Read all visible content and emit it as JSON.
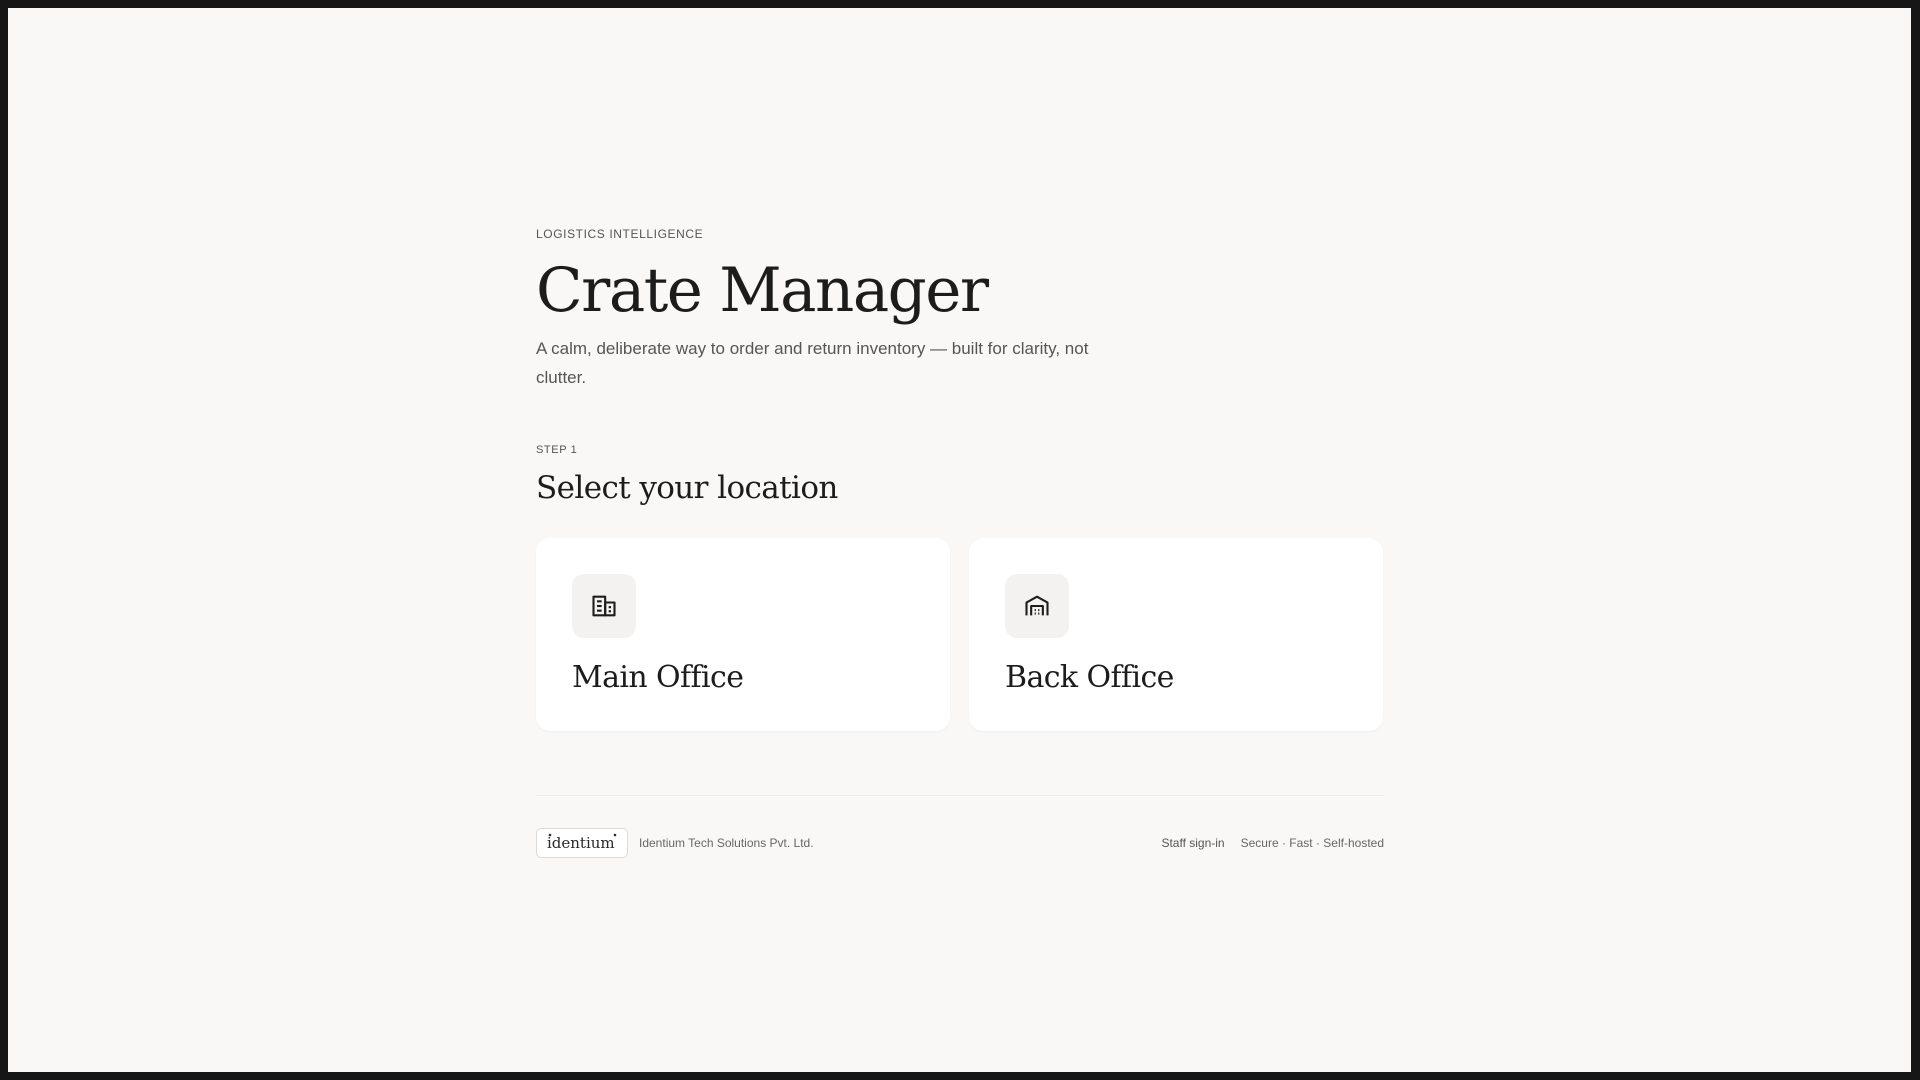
{
  "hero": {
    "eyebrow": "LOGISTICS INTELLIGENCE",
    "title": "Crate Manager",
    "subtitle": "A calm, deliberate way to order and return inventory — built for clarity, not clutter."
  },
  "step": {
    "label": "STEP 1",
    "title": "Select your location"
  },
  "locations": [
    {
      "label": "Main Office",
      "icon": "building-icon"
    },
    {
      "label": "Back Office",
      "icon": "warehouse-icon"
    }
  ],
  "footer": {
    "logo_text": "identium",
    "company": "Identium Tech Solutions Pvt. Ltd.",
    "staff_link": "Staff sign-in",
    "tagline": "Secure · Fast · Self-hosted"
  },
  "colors": {
    "background": "#f9f8f6",
    "card": "#ffffff",
    "text": "#1c1c1c",
    "muted": "#555555"
  }
}
